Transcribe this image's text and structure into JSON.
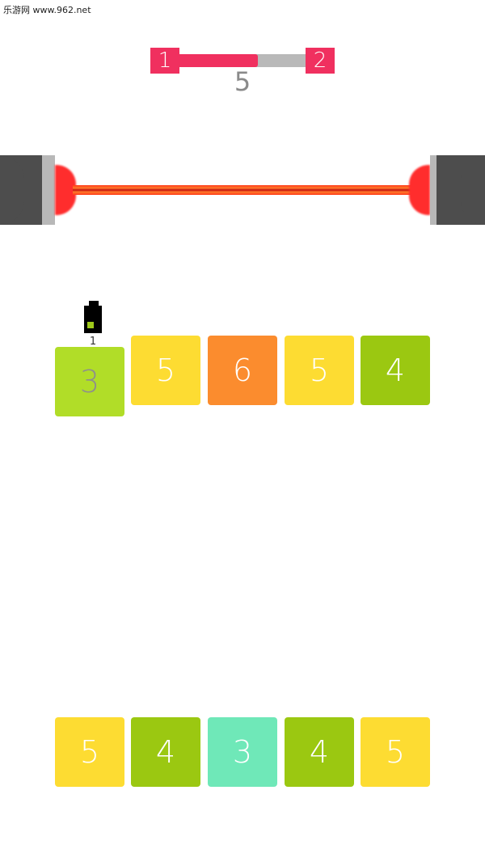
{
  "watermark": {
    "top_text": "乐游网 www.962.net"
  },
  "level": {
    "current": "1",
    "next": "2",
    "progress_fraction": 0.62,
    "moves": "5"
  },
  "battery": {
    "count": "1"
  },
  "colors": {
    "accent": "#f0305f",
    "yellow": "#fddc32",
    "orange": "#fb8c2e",
    "lime": "#b1dd28",
    "green": "#9bc811",
    "mint": "#6fe8b8",
    "laser": "#ff2d2d",
    "emitter": "#4d4d4d"
  },
  "top_row": [
    {
      "value": "3",
      "color": "#b1dd28",
      "selected": true
    },
    {
      "value": "5",
      "color": "#fddc32",
      "selected": false
    },
    {
      "value": "6",
      "color": "#fb8c2e",
      "selected": false
    },
    {
      "value": "5",
      "color": "#fddc32",
      "selected": false
    },
    {
      "value": "4",
      "color": "#9bc811",
      "selected": false
    }
  ],
  "bottom_row": [
    {
      "value": "5",
      "color": "#fddc32"
    },
    {
      "value": "4",
      "color": "#9bc811"
    },
    {
      "value": "3",
      "color": "#6fe8b8"
    },
    {
      "value": "4",
      "color": "#9bc811"
    },
    {
      "value": "5",
      "color": "#fddc32"
    }
  ],
  "icons": [
    "battery-icon",
    "laser-emitter-icon"
  ]
}
